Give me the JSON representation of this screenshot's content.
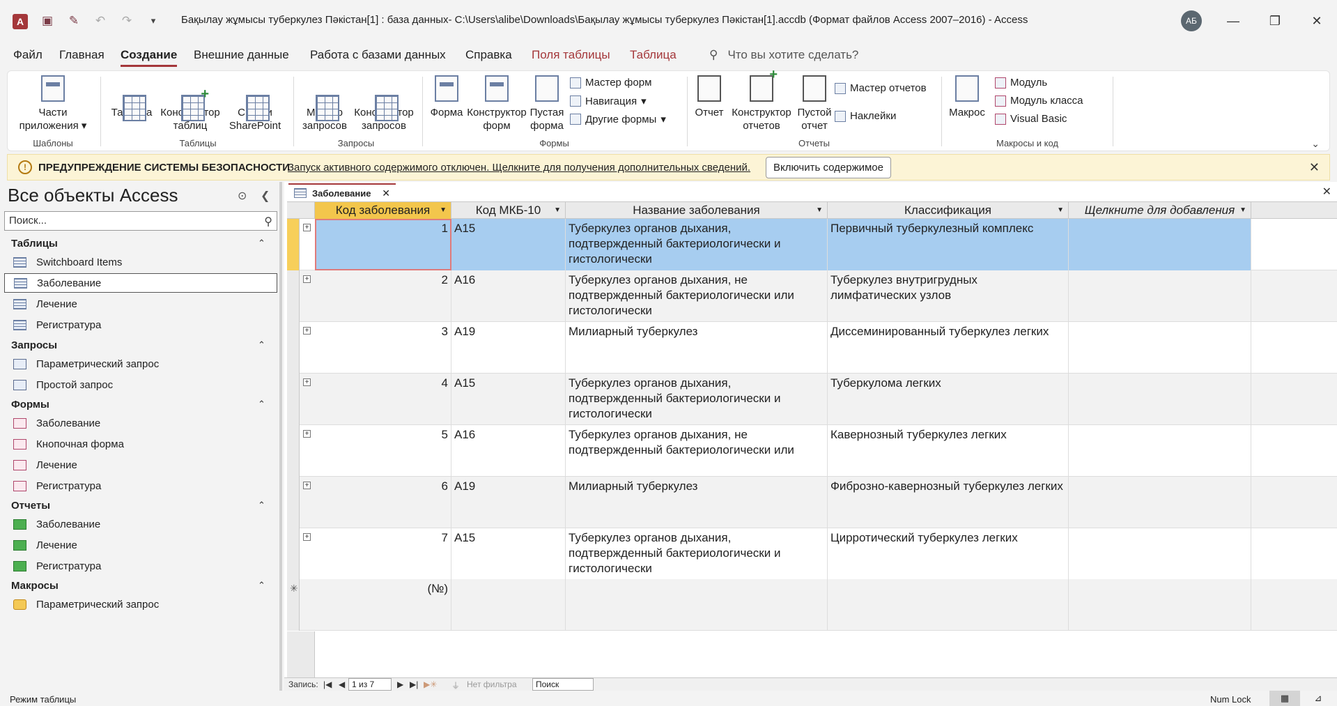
{
  "window": {
    "title": "Бақылау жұмысы туберкулез Пәкістан[1] : база данных- C:\\Users\\alibe\\Downloads\\Бақылау жұмысы туберкулез Пәкістан[1].accdb (Формат файлов Access 2007–2016)  -  Access",
    "avatar_initials": "АБ",
    "app_letter": "A"
  },
  "menu": {
    "items": [
      "Файл",
      "Главная",
      "Создание",
      "Внешние данные",
      "Работа с базами данных",
      "Справка",
      "Поля таблицы",
      "Таблица"
    ],
    "active": "Создание",
    "search_placeholder": "Что вы хотите сделать?"
  },
  "ribbon": {
    "templates": {
      "btn": "Части приложения",
      "label": "Шаблоны"
    },
    "tables": {
      "table": "Таблица",
      "designer": "Конструктор таблиц",
      "sharepoint": "Списки SharePoint",
      "label": "Таблицы"
    },
    "queries": {
      "wizard": "Мастер запросов",
      "designer": "Конструктор запросов",
      "label": "Запросы"
    },
    "forms": {
      "form": "Форма",
      "designer": "Конструктор форм",
      "blank": "Пустая форма",
      "wizard": "Мастер форм",
      "navigation": "Навигация",
      "more": "Другие формы",
      "label": "Формы"
    },
    "reports": {
      "report": "Отчет",
      "designer": "Конструктор отчетов",
      "blank": "Пустой отчет",
      "wizard": "Мастер отчетов",
      "labels": "Наклейки",
      "label": "Отчеты"
    },
    "macros": {
      "macro": "Макрос",
      "module": "Модуль",
      "class_module": "Модуль класса",
      "vb": "Visual Basic",
      "label": "Макросы и код"
    }
  },
  "security": {
    "title": "ПРЕДУПРЕЖДЕНИЕ СИСТЕМЫ БЕЗОПАСНОСТИ",
    "message": "Запуск активного содержимого отключен. Щелкните для получения дополнительных сведений.",
    "button": "Включить содержимое"
  },
  "nav": {
    "title": "Все объекты Access",
    "search_placeholder": "Поиск...",
    "groups": [
      {
        "name": "Таблицы",
        "items": [
          "Switchboard Items",
          "Заболевание",
          "Лечение",
          "Регистратура"
        ]
      },
      {
        "name": "Запросы",
        "items": [
          "Параметрический запрос",
          "Простой запрос"
        ]
      },
      {
        "name": "Формы",
        "items": [
          "Заболевание",
          "Кнопочная форма",
          "Лечение",
          "Регистратура"
        ]
      },
      {
        "name": "Отчеты",
        "items": [
          "Заболевание",
          "Лечение",
          "Регистратура"
        ]
      },
      {
        "name": "Макросы",
        "items": [
          "Параметрический запрос"
        ]
      }
    ],
    "selected": "Заболевание"
  },
  "document": {
    "tab": "Заболевание",
    "columns": [
      "Код заболевания",
      "Код МКБ-10",
      "Название заболевания",
      "Классификация",
      "Щелкните для добавления"
    ],
    "rows": [
      {
        "id": "1",
        "code": "A15",
        "name": "Туберкулез органов дыхания, подтвержденный бактериологически и гистологически",
        "class": "Первичный туберкулезный комплекс"
      },
      {
        "id": "2",
        "code": "A16",
        "name": "Туберкулез органов дыхания, не подтвержденный бактериологически или гистологически",
        "class": "Туберкулез внутригрудных лимфатических узлов"
      },
      {
        "id": "3",
        "code": "A19",
        "name": "Милиарный туберкулез",
        "class": "Диссеминированный туберкулез легких"
      },
      {
        "id": "4",
        "code": "A15",
        "name": "Туберкулез органов дыхания, подтвержденный бактериологически и гистологически",
        "class": "Туберкулома легких"
      },
      {
        "id": "5",
        "code": "A16",
        "name": "Туберкулез органов дыхания, не подтвержденный бактериологически или",
        "class": "Кавернозный туберкулез легких"
      },
      {
        "id": "6",
        "code": "A19",
        "name": "Милиарный туберкулез",
        "class": "Фиброзно-кавернозный туберкулез легких"
      },
      {
        "id": "7",
        "code": "A15",
        "name": "Туберкулез органов дыхания, подтвержденный бактериологически и гистологически",
        "class": "Цирротический туберкулез легких"
      }
    ],
    "new_row_id": "(№)"
  },
  "record_nav": {
    "label": "Запись:",
    "position": "1 из 7",
    "filter": "Нет фильтра",
    "search": "Поиск"
  },
  "status": {
    "mode": "Режим таблицы",
    "numlock": "Num Lock"
  }
}
